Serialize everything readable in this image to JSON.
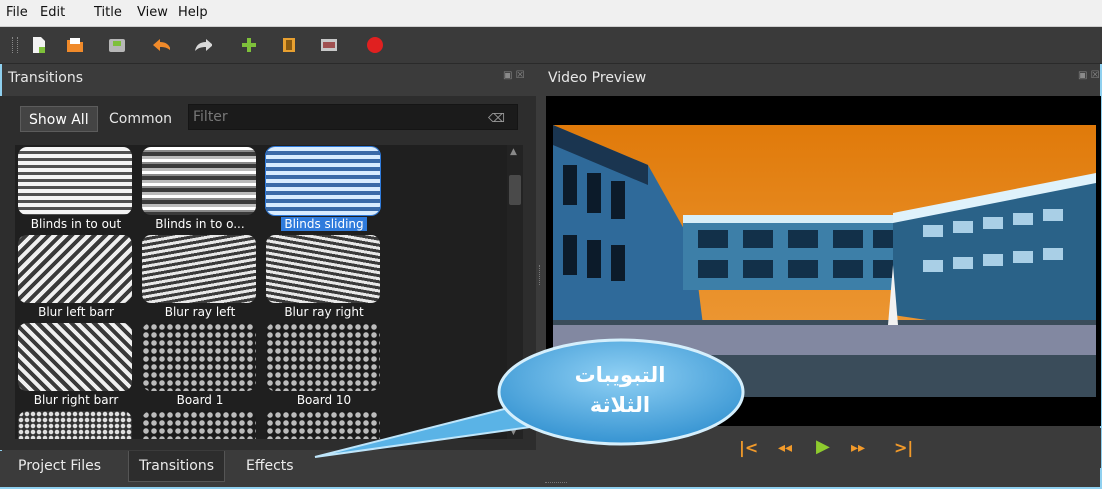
{
  "menu": [
    "File",
    "Edit",
    "Title",
    "View",
    "Help"
  ],
  "toolbar": {
    "icons": [
      "new-project-icon",
      "open-project-icon",
      "save-project-icon",
      "undo-icon",
      "redo-icon",
      "import-files-icon",
      "profile-icon",
      "fullscreen-icon",
      "export-video-icon"
    ]
  },
  "transitions_panel": {
    "title": "Transitions",
    "filter_buttons": [
      "Show All",
      "Common"
    ],
    "filter_placeholder": "Filter",
    "items": [
      {
        "label": "Blinds in to out",
        "selected": false
      },
      {
        "label": "Blinds in to o...",
        "selected": false
      },
      {
        "label": "Blinds sliding",
        "selected": true
      },
      {
        "label": "Blur left barr",
        "selected": false
      },
      {
        "label": "Blur ray left",
        "selected": false
      },
      {
        "label": "Blur ray right",
        "selected": false
      },
      {
        "label": "Blur right barr",
        "selected": false
      },
      {
        "label": "Board 1",
        "selected": false
      },
      {
        "label": "Board 10",
        "selected": false
      }
    ]
  },
  "bottom_tabs": [
    "Project Files",
    "Transitions",
    "Effects"
  ],
  "video_preview": {
    "title": "Video Preview",
    "controls": [
      "jump-start-icon",
      "rewind-icon",
      "play-icon",
      "fast-forward-icon",
      "jump-end-icon"
    ]
  },
  "callout": {
    "line1": "التبويبات",
    "line2": "الثلاثة"
  },
  "colors": {
    "accent": "#f29a2a",
    "selection": "#2f7bdc",
    "callout": "#4aa8e0"
  }
}
